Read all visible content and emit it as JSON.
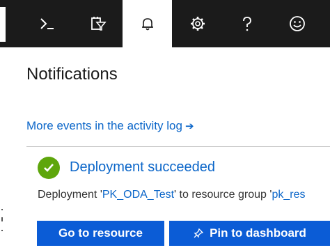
{
  "toolbar": {
    "items": [
      {
        "icon": "cloud-shell-icon"
      },
      {
        "icon": "directory-filter-icon"
      },
      {
        "icon": "bell-icon",
        "active": true
      },
      {
        "icon": "gear-icon"
      },
      {
        "icon": "help-icon"
      },
      {
        "icon": "feedback-smiley-icon"
      }
    ]
  },
  "notifications": {
    "title": "Notifications",
    "activity_link": "More events in the activity log",
    "activity_arrow": "➔",
    "item": {
      "title": "Deployment succeeded",
      "desc_prefix": "Deployment '",
      "desc_deployment": "PK_ODA_Test",
      "desc_middle": "' to resource group '",
      "desc_group": "pk_res"
    },
    "buttons": {
      "go_to_resource": "Go to resource",
      "pin_to_dashboard": "Pin to dashboard"
    }
  },
  "colors": {
    "topbar": "#1b1b1b",
    "accent": "#0b66c9",
    "button": "#0b5cd6",
    "success": "#5ea60c"
  }
}
